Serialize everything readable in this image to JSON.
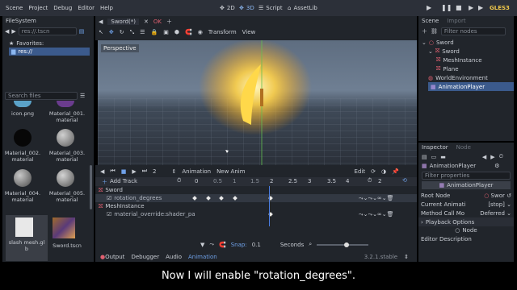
{
  "menu": [
    "Scene",
    "Project",
    "Debug",
    "Editor",
    "Help"
  ],
  "modes": {
    "m2d": "2D",
    "m3d": "3D",
    "script": "Script",
    "assetlib": "AssetLib"
  },
  "renderer": "GLES3",
  "filesystem": {
    "title": "FileSystem",
    "path": "res://.tscn",
    "favorites_label": "Favorites:",
    "res_label": "res://",
    "search_placeholder": "Search files",
    "files": [
      "icon.png",
      "Material_001.\nmaterial",
      "Material_002.\nmaterial",
      "Material_003.\nmaterial",
      "Material_004.\nmaterial",
      "Material_005.\nmaterial",
      "slash mesh.gl\nb",
      "Sword.tscn"
    ]
  },
  "viewport": {
    "tab": "Sword(*)",
    "tab2": "OK",
    "transform": "Transform",
    "view": "View",
    "perspective": "Perspective"
  },
  "scene": {
    "title": "Scene",
    "import": "Import",
    "filter": "Filter nodes",
    "nodes": [
      "Sword",
      "Sword",
      "MeshInstance",
      "Plane",
      "WorldEnvironment",
      "AnimationPlayer"
    ]
  },
  "animation": {
    "frame": "2",
    "label": "Animation",
    "anim_name": "New Anim",
    "edit": "Edit",
    "length": "2",
    "add_track": "Add Track",
    "ticks": [
      "0",
      "0.5",
      "1",
      "1.5",
      "2",
      "2.5",
      "3",
      "3.5",
      "4"
    ],
    "sections": [
      "Sword",
      "MeshInstance"
    ],
    "tracks": [
      "rotation_degrees",
      "material_override:shader_pa"
    ],
    "snap_label": "Snap:",
    "snap_value": "0.1",
    "seconds": "Seconds"
  },
  "bottom_tabs": [
    "Output",
    "Debugger",
    "Audio",
    "Animation"
  ],
  "version": "3.2.1.stable",
  "inspector": {
    "title": "Inspector",
    "node_tab": "Node",
    "object": "AnimationPlayer",
    "filter": "Filter properties",
    "header": "AnimationPlayer",
    "props": [
      {
        "k": "Root Node",
        "v": "Swor"
      },
      {
        "k": "Current Animati",
        "v": "[stop]"
      },
      {
        "k": "Method Call Mo",
        "v": "Deferred"
      }
    ],
    "playback": "Playback Options",
    "node": "Node",
    "editor_desc": "Editor Description"
  },
  "subtitle": "Now I will enable \"rotation_degrees\"."
}
